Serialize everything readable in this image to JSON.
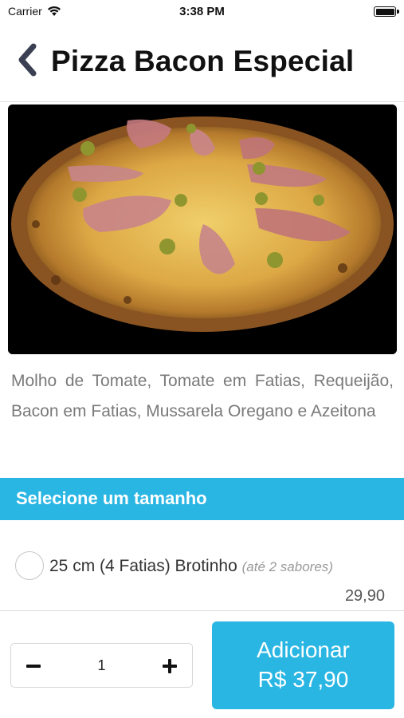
{
  "status_bar": {
    "carrier": "Carrier",
    "time": "3:38 PM"
  },
  "header": {
    "title": "Pizza Bacon Especial",
    "back_icon": "chevron-left-icon"
  },
  "product": {
    "description": "Molho de Tomate, Tomate em Fatias, Requeijão, Bacon em Fatias, Mussarela Oregano e Azeitona"
  },
  "size_section": {
    "title": "Selecione um tamanho",
    "options": [
      {
        "label": "25 cm (4 Fatias) Brotinho",
        "note": "(até 2 sabores)",
        "price": "29,90",
        "selected": false
      }
    ]
  },
  "cart": {
    "quantity": "1",
    "add_label": "Adicionar",
    "add_price": "R$ 37,90"
  },
  "colors": {
    "accent": "#2ab6e3",
    "header_text": "#111111",
    "description_text": "#7a7a7a"
  }
}
